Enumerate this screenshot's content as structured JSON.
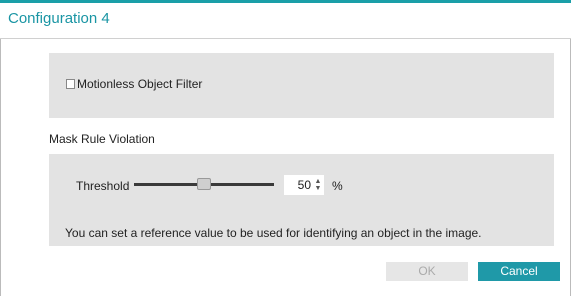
{
  "dialog": {
    "title": "Configuration 4"
  },
  "filter": {
    "motionless_label": "Motionless Object Filter",
    "checked": false
  },
  "mask_rule": {
    "section_label": "Mask Rule Violation",
    "threshold_label": "Threshold",
    "threshold_value": "50",
    "threshold_unit": "%",
    "slider_level_percent": 50,
    "info_text": "You can set a reference value to be used for identifying an object in the image."
  },
  "buttons": {
    "ok_label": "OK",
    "cancel_label": "Cancel"
  },
  "icons": {
    "spin_up": "▲",
    "spin_down": "▼"
  },
  "colors": {
    "accent": "#1a9fa8",
    "panel_bg": "#e3e3e3",
    "disabled_button": "#e6e6e6"
  }
}
